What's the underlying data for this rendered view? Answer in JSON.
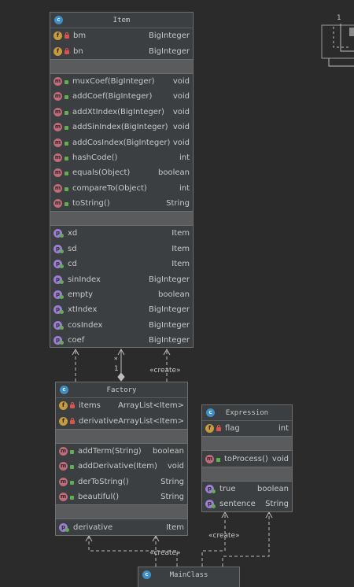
{
  "colors": {
    "background": "#2b2b2b",
    "class_fill": "#3c3f41",
    "border": "#6e6e6e",
    "field_icon": "#c79a3c",
    "method_icon": "#c06a7a",
    "property_icon": "#9b7fd1",
    "class_icon": "#3d8fc6"
  },
  "item": {
    "title": "Item",
    "fields": [
      {
        "name": "bm",
        "type": "BigInteger",
        "icon": "f"
      },
      {
        "name": "bn",
        "type": "BigInteger",
        "icon": "f"
      }
    ],
    "methods": [
      {
        "name": "muxCoef(BigInteger)",
        "type": "void",
        "icon": "m"
      },
      {
        "name": "addCoef(BigInteger)",
        "type": "void",
        "icon": "m"
      },
      {
        "name": "addXtIndex(BigInteger)",
        "type": "void",
        "icon": "m"
      },
      {
        "name": "addSinIndex(BigInteger)",
        "type": "void",
        "icon": "m"
      },
      {
        "name": "addCosIndex(BigInteger)",
        "type": "void",
        "icon": "m"
      },
      {
        "name": "hashCode()",
        "type": "int",
        "icon": "m"
      },
      {
        "name": "equals(Object)",
        "type": "boolean",
        "icon": "m"
      },
      {
        "name": "compareTo(Object)",
        "type": "int",
        "icon": "m"
      },
      {
        "name": "toString()",
        "type": "String",
        "icon": "m"
      }
    ],
    "properties": [
      {
        "name": "xd",
        "type": "Item",
        "icon": "p"
      },
      {
        "name": "sd",
        "type": "Item",
        "icon": "p"
      },
      {
        "name": "cd",
        "type": "Item",
        "icon": "p"
      },
      {
        "name": "sinIndex",
        "type": "BigInteger",
        "icon": "p"
      },
      {
        "name": "empty",
        "type": "boolean",
        "icon": "p"
      },
      {
        "name": "xtIndex",
        "type": "BigInteger",
        "icon": "p"
      },
      {
        "name": "cosIndex",
        "type": "BigInteger",
        "icon": "p"
      },
      {
        "name": "coef",
        "type": "BigInteger",
        "icon": "p"
      }
    ]
  },
  "factory": {
    "title": "Factory",
    "fields": [
      {
        "name": "items",
        "type": "ArrayList<Item>",
        "icon": "f"
      },
      {
        "name": "derivative",
        "type": "ArrayList<Item>",
        "icon": "f"
      }
    ],
    "methods": [
      {
        "name": "addTerm(String)",
        "type": "boolean",
        "icon": "m"
      },
      {
        "name": "addDerivative(Item)",
        "type": "void",
        "icon": "m"
      },
      {
        "name": "derToString()",
        "type": "String",
        "icon": "m"
      },
      {
        "name": "beautiful()",
        "type": "String",
        "icon": "m"
      }
    ],
    "properties": [
      {
        "name": "derivative",
        "type": "Item",
        "icon": "p"
      }
    ]
  },
  "expression": {
    "title": "Expression",
    "fields": [
      {
        "name": "flag",
        "type": "int",
        "icon": "f"
      }
    ],
    "methods": [
      {
        "name": "toProcess()",
        "type": "void",
        "icon": "m"
      }
    ],
    "properties": [
      {
        "name": "true",
        "type": "boolean",
        "icon": "p"
      },
      {
        "name": "sentence",
        "type": "String",
        "icon": "p"
      }
    ]
  },
  "mainclass": {
    "title": "MainClass"
  },
  "labels": {
    "create1": "«create»",
    "create2": "«create»",
    "create3": "«create»",
    "mult_star": "*",
    "mult_one": "1",
    "self_one": "1",
    "icon_f": "f",
    "icon_m": "m",
    "icon_p": "p",
    "icon_c": "c"
  }
}
